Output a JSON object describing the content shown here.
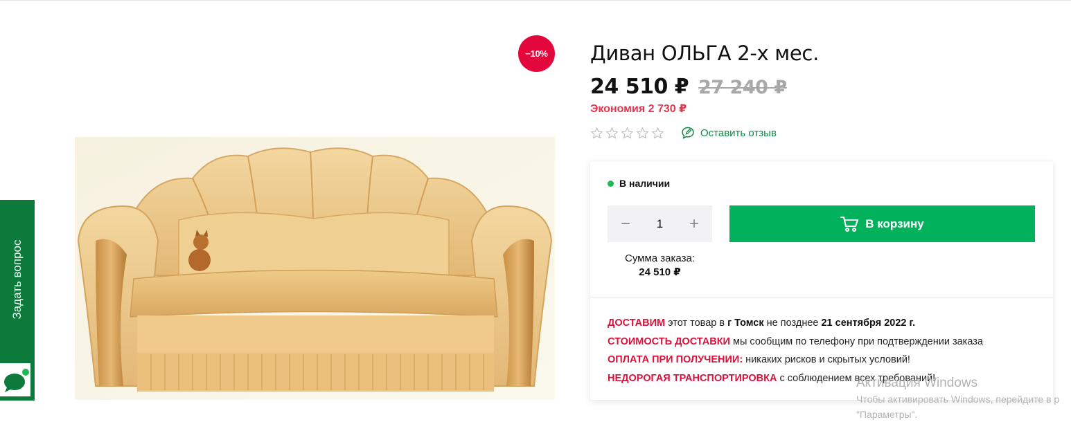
{
  "ask_tab": {
    "label": "Задать вопрос",
    "color": "#0b7a3b"
  },
  "product": {
    "title": "Диван ОЛЬГА 2-х мес.",
    "discount_badge": "−10%",
    "price_current": "24 510 ₽",
    "price_old": "27 240 ₽",
    "savings": "Экономия 2 730 ₽",
    "rating": {
      "value": 0,
      "max": 5
    },
    "review_link": "Оставить отзыв"
  },
  "buy_card": {
    "stock_status": "В наличии",
    "quantity": "1",
    "qty_minus": "−",
    "qty_plus": "+",
    "cart_button": "В корзину",
    "order_sum_label": "Сумма заказа:",
    "order_sum_value": "24 510 ₽",
    "delivery": {
      "hl": "ДОСТАВИМ",
      "text1": " этот товар в ",
      "city": "г Томск",
      "text2": " не позднее ",
      "date": "21 сентября 2022 г."
    },
    "delivery_cost": {
      "hl": "СТОИМОСТЬ ДОСТАВКИ",
      "text": " мы сообщим по телефону при подтверждении заказа"
    },
    "payment": {
      "hl": "ОПЛАТА ПРИ ПОЛУЧЕНИИ:",
      "text": " никаких рисков и скрытых условий!"
    },
    "transport": {
      "hl": "НЕДОРОГАЯ ТРАНСПОРТИРОВКА",
      "text": " с соблюдением всех требований!"
    }
  },
  "watermark": {
    "title": "Активация Windows",
    "line1": "Чтобы активировать Windows, перейдите в р",
    "line2": "\"Параметры\"."
  },
  "colors": {
    "accent_green": "#02b15c",
    "discount_red": "#e3073c",
    "savings_red": "#e2364e",
    "link_green": "#0b8a45"
  }
}
